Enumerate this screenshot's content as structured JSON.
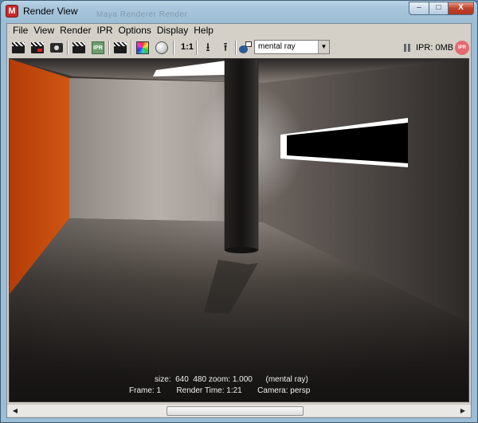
{
  "window": {
    "title": "Render View",
    "ghost_title": "Maya  Renderer  Render",
    "controls": {
      "minimize": "–",
      "maximize": "□",
      "close": "X"
    }
  },
  "menubar": {
    "items": [
      "File",
      "View",
      "Render",
      "IPR",
      "Options",
      "Display",
      "Help"
    ]
  },
  "toolbar": {
    "icons": [
      "redo-render-icon",
      "render-region-icon",
      "snapshot-icon",
      "render-sequence-icon",
      "ipr-render-icon",
      "keep-image-icon",
      "display-rgb-icon",
      "display-alpha-icon",
      "keep-image-down-icon",
      "remove-image-up-icon",
      "teapot-icon"
    ],
    "real_size_label": "1:1",
    "ipr_label": "IPR",
    "renderer": "mental ray",
    "ipr_memory": "IPR: 0MB",
    "ipr_badge": "IPR"
  },
  "viewport": {
    "info_line1": "size:  640  480 zoom: 1.000      (mental ray)",
    "info_line2": "Frame: 1       Render Time: 1:21       Camera: persp"
  },
  "colors": {
    "orange_wall": "#c64a0c",
    "back_wall": "#9c948e",
    "floor": "#5a504a",
    "ceiling": "#8a827c",
    "column": "#1e1d1c"
  }
}
